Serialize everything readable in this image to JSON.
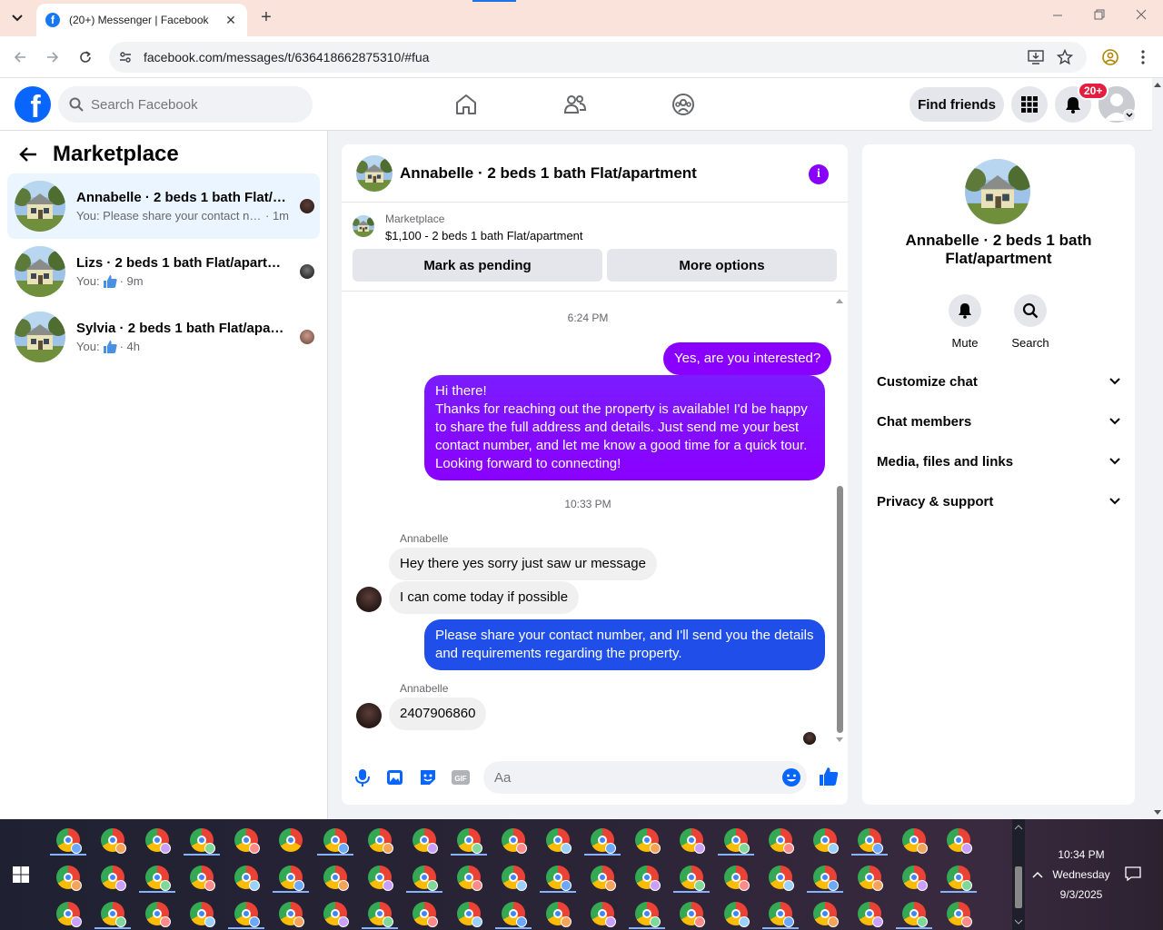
{
  "browser": {
    "tab_title": "(20+) Messenger | Facebook",
    "url": "facebook.com/messages/t/636418662875310/#fua"
  },
  "header": {
    "search_placeholder": "Search Facebook",
    "find_friends": "Find friends",
    "notif_badge": "20+"
  },
  "sidebar": {
    "title": "Marketplace",
    "conversations": [
      {
        "name": "Annabelle · 2 beds 1 bath Flat/a...",
        "preview": "You: Please share your contact nu...",
        "time": "· 1m",
        "active": true
      },
      {
        "name": "Lizs · 2 beds 1 bath Flat/apartme...",
        "preview": "You:",
        "time": "· 9m",
        "active": false
      },
      {
        "name": "Sylvia · 2 beds 1 bath Flat/apart...",
        "preview": "You:",
        "time": "· 4h",
        "active": false
      }
    ]
  },
  "chat": {
    "title": "Annabelle · 2 beds 1 bath Flat/apartment",
    "listing_label": "Marketplace",
    "listing_price": "$1,100 - 2 beds 1 bath Flat/apartment",
    "mark_pending": "Mark as pending",
    "more_options": "More options",
    "ts1": "6:24 PM",
    "msg_out1": "Yes, are you interested?",
    "msg_out2_lines": [
      "Hi there!",
      "Thanks for reaching out the property is available! I'd be happy",
      "to share the full address and details. Just send me your best",
      "contact number, and let me know a good time for a quick tour.",
      "Looking forward to connecting!"
    ],
    "ts2": "10:33 PM",
    "sender1": "Annabelle",
    "msg_in1": "Hey there yes sorry just saw ur message",
    "msg_in2": "I can come today if possible",
    "msg_out3_lines": [
      "Please share your contact number, and I'll send you the details",
      "and requirements regarding the property."
    ],
    "sender2": "Annabelle",
    "msg_in3": "2407906860",
    "composer_placeholder": "Aa"
  },
  "info_panel": {
    "name": "Annabelle · 2 beds 1 bath Flat/apartment",
    "mute": "Mute",
    "search": "Search",
    "rows": [
      "Customize chat",
      "Chat members",
      "Media, files and links",
      "Privacy & support"
    ]
  },
  "taskbar": {
    "time": "10:34 PM",
    "day": "Wednesday",
    "date": "9/3/2025"
  },
  "colors": {
    "facebook_blue": "#0866ff",
    "outgoing_purple": "#8a00ff",
    "outgoing_blue": "#1f4fe8",
    "active_conv": "#ebf5ff",
    "badge_red": "#e41e3f"
  }
}
